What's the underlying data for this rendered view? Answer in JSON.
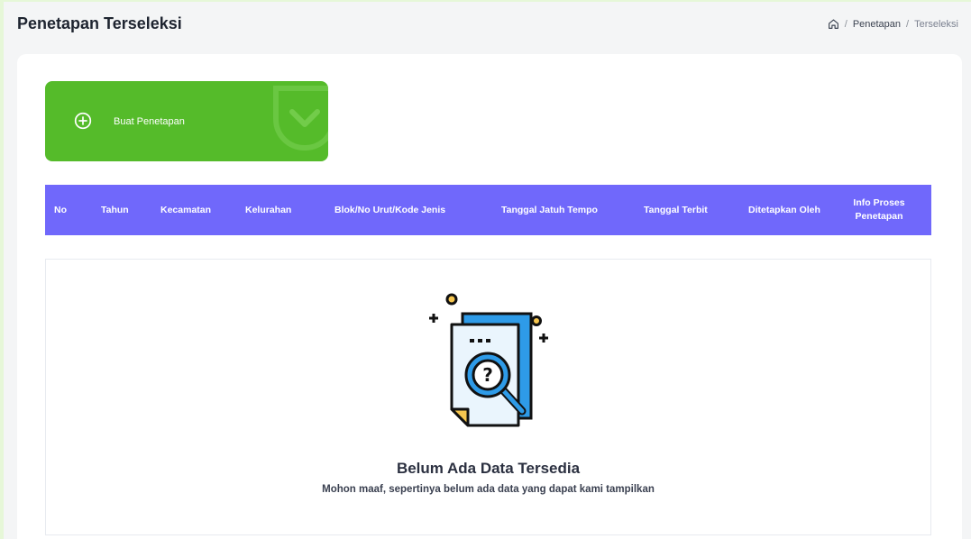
{
  "header": {
    "title": "Penetapan Terseleksi",
    "breadcrumb": {
      "home_icon": "home-icon",
      "items": [
        "Penetapan",
        "Terseleksi"
      ],
      "separator": "/"
    }
  },
  "create_button": {
    "label": "Buat Penetapan",
    "icon": "plus-circle-icon",
    "color": "#55bb2a"
  },
  "table": {
    "header_color": "#7068fb",
    "columns": [
      "No",
      "Tahun",
      "Kecamatan",
      "Kelurahan",
      "Blok/No Urut/Kode Jenis",
      "Tanggal Jatuh Tempo",
      "Tanggal Terbit",
      "Ditetapkan Oleh",
      "Info Proses Penetapan"
    ]
  },
  "empty_state": {
    "title": "Belum Ada Data Tersedia",
    "message": "Mohon maaf, sepertinya belum ada data yang dapat kami tampilkan",
    "icon": "document-search-icon"
  }
}
